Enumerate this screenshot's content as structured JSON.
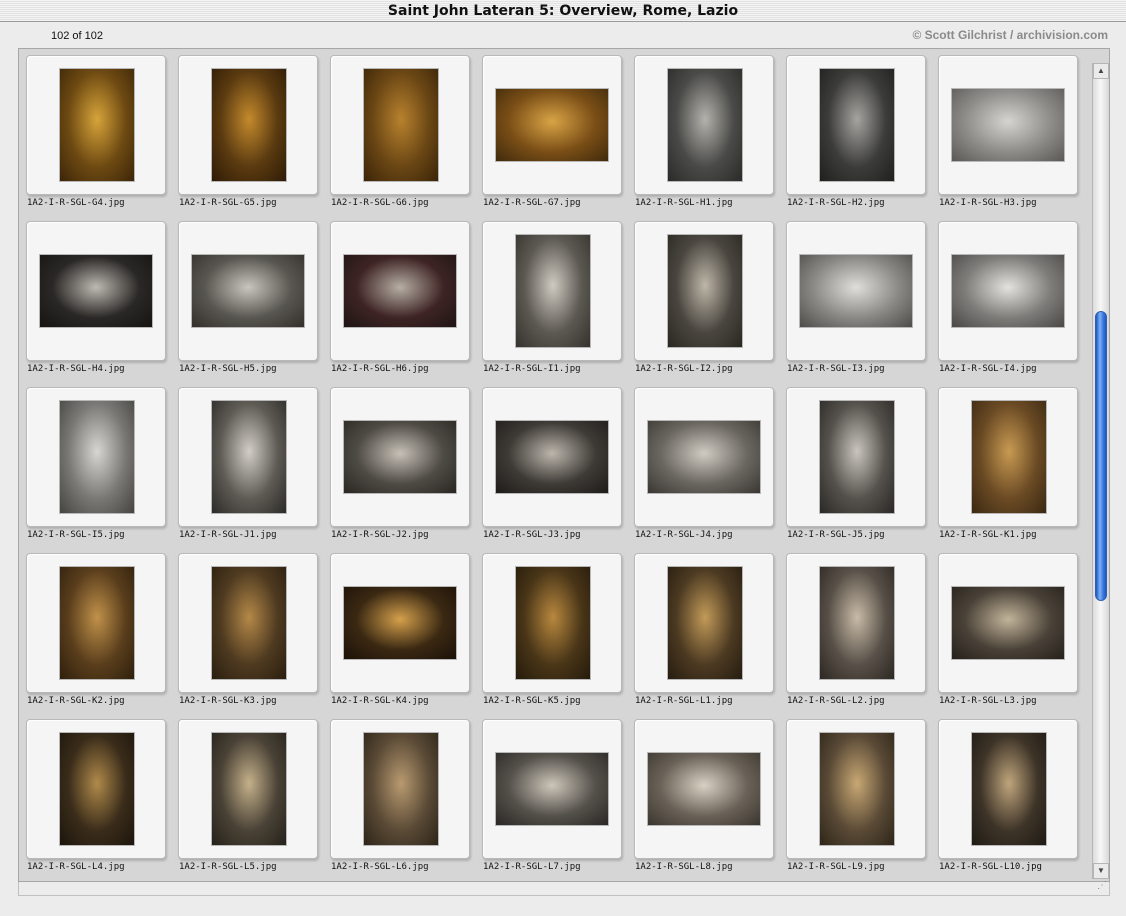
{
  "window": {
    "title": "Saint John Lateran 5: Overview, Rome, Lazio"
  },
  "info": {
    "counter": "102 of 102",
    "copyright": "© Scott Gilchrist / archivision.com"
  },
  "thumbnails": [
    {
      "label": "1A2-I-R-SGL-G4.jpg",
      "orientation": "portrait",
      "colors": [
        "#6e4a12",
        "#d7a43a",
        "#3b2508"
      ]
    },
    {
      "label": "1A2-I-R-SGL-G5.jpg",
      "orientation": "portrait",
      "colors": [
        "#5a3a10",
        "#c48a2c",
        "#2e1b06"
      ]
    },
    {
      "label": "1A2-I-R-SGL-G6.jpg",
      "orientation": "portrait",
      "colors": [
        "#6a4614",
        "#b8822e",
        "#3a2408"
      ]
    },
    {
      "label": "1A2-I-R-SGL-G7.jpg",
      "orientation": "landscape",
      "colors": [
        "#7a4e16",
        "#d9a446",
        "#3f2a0c"
      ]
    },
    {
      "label": "1A2-I-R-SGL-H1.jpg",
      "orientation": "portrait",
      "colors": [
        "#4a4a48",
        "#b4b2ac",
        "#2a2a28"
      ]
    },
    {
      "label": "1A2-I-R-SGL-H2.jpg",
      "orientation": "portrait",
      "colors": [
        "#3c3c3a",
        "#a6a4a0",
        "#1f1f1e"
      ]
    },
    {
      "label": "1A2-I-R-SGL-H3.jpg",
      "orientation": "landscape",
      "colors": [
        "#8e8c88",
        "#d6d4d0",
        "#5a5855"
      ]
    },
    {
      "label": "1A2-I-R-SGL-H4.jpg",
      "orientation": "landscape",
      "colors": [
        "#2a2826",
        "#bdb9b2",
        "#151413"
      ]
    },
    {
      "label": "1A2-I-R-SGL-H5.jpg",
      "orientation": "landscape",
      "colors": [
        "#585650",
        "#c8c5be",
        "#322f2b"
      ]
    },
    {
      "label": "1A2-I-R-SGL-H6.jpg",
      "orientation": "landscape",
      "colors": [
        "#3e2424",
        "#b6aea4",
        "#1f1414"
      ]
    },
    {
      "label": "1A2-I-R-SGL-I1.jpg",
      "orientation": "portrait",
      "colors": [
        "#5c5852",
        "#cfcac1",
        "#35322d"
      ]
    },
    {
      "label": "1A2-I-R-SGL-I2.jpg",
      "orientation": "portrait",
      "colors": [
        "#4a463f",
        "#bdb6a9",
        "#2a2722"
      ]
    },
    {
      "label": "1A2-I-R-SGL-I3.jpg",
      "orientation": "landscape",
      "colors": [
        "#8a8884",
        "#e0dedb",
        "#4e4c49"
      ]
    },
    {
      "label": "1A2-I-R-SGL-I4.jpg",
      "orientation": "landscape",
      "colors": [
        "#7e7c79",
        "#e4e2de",
        "#4a4846"
      ]
    },
    {
      "label": "1A2-I-R-SGL-I5.jpg",
      "orientation": "portrait",
      "colors": [
        "#7a7874",
        "#d8d6d2",
        "#45433f"
      ]
    },
    {
      "label": "1A2-I-R-SGL-J1.jpg",
      "orientation": "portrait",
      "colors": [
        "#5e5b55",
        "#d2cec6",
        "#2c2a27"
      ]
    },
    {
      "label": "1A2-I-R-SGL-J2.jpg",
      "orientation": "landscape",
      "colors": [
        "#4e4a44",
        "#c6c0b6",
        "#2a2723"
      ]
    },
    {
      "label": "1A2-I-R-SGL-J3.jpg",
      "orientation": "landscape",
      "colors": [
        "#3e3a36",
        "#bcb6ac",
        "#1e1c19"
      ]
    },
    {
      "label": "1A2-I-R-SGL-J4.jpg",
      "orientation": "landscape",
      "colors": [
        "#6a6660",
        "#d0cbc2",
        "#3a3733"
      ]
    },
    {
      "label": "1A2-I-R-SGL-J5.jpg",
      "orientation": "portrait",
      "colors": [
        "#55524d",
        "#c9c5bd",
        "#2a2825"
      ]
    },
    {
      "label": "1A2-I-R-SGL-K1.jpg",
      "orientation": "portrait",
      "colors": [
        "#6a4a24",
        "#c89a52",
        "#3a2812"
      ]
    },
    {
      "label": "1A2-I-R-SGL-K2.jpg",
      "orientation": "portrait",
      "colors": [
        "#5a3e1c",
        "#c0914a",
        "#2e1f0d"
      ]
    },
    {
      "label": "1A2-I-R-SGL-K3.jpg",
      "orientation": "portrait",
      "colors": [
        "#4e3a20",
        "#b48848",
        "#2a1e0f"
      ]
    },
    {
      "label": "1A2-I-R-SGL-K4.jpg",
      "orientation": "landscape",
      "colors": [
        "#3a2812",
        "#d4a04c",
        "#1c1208"
      ]
    },
    {
      "label": "1A2-I-R-SGL-K5.jpg",
      "orientation": "portrait",
      "colors": [
        "#4a3618",
        "#b8883e",
        "#241a0b"
      ]
    },
    {
      "label": "1A2-I-R-SGL-L1.jpg",
      "orientation": "portrait",
      "colors": [
        "#4c3a22",
        "#c29a58",
        "#261c10"
      ]
    },
    {
      "label": "1A2-I-R-SGL-L2.jpg",
      "orientation": "portrait",
      "colors": [
        "#585048",
        "#c8bba6",
        "#2c2722"
      ]
    },
    {
      "label": "1A2-I-R-SGL-L3.jpg",
      "orientation": "landscape",
      "colors": [
        "#4a4238",
        "#c2b49a",
        "#25201b"
      ]
    },
    {
      "label": "1A2-I-R-SGL-L4.jpg",
      "orientation": "portrait",
      "colors": [
        "#3a2c1a",
        "#b08a4a",
        "#1c150c"
      ]
    },
    {
      "label": "1A2-I-R-SGL-L5.jpg",
      "orientation": "portrait",
      "colors": [
        "#4a4236",
        "#c4b08a",
        "#25211a"
      ]
    },
    {
      "label": "1A2-I-R-SGL-L6.jpg",
      "orientation": "portrait",
      "colors": [
        "#5a4a36",
        "#b89a70",
        "#2c2418"
      ]
    },
    {
      "label": "1A2-I-R-SGL-L7.jpg",
      "orientation": "landscape",
      "colors": [
        "#54504a",
        "#cdc6ba",
        "#2a2825"
      ]
    },
    {
      "label": "1A2-I-R-SGL-L8.jpg",
      "orientation": "landscape",
      "colors": [
        "#6a6258",
        "#d8d0c2",
        "#3a352e"
      ]
    },
    {
      "label": "1A2-I-R-SGL-L9.jpg",
      "orientation": "portrait",
      "colors": [
        "#5a4a36",
        "#c8a874",
        "#2e2518"
      ]
    },
    {
      "label": "1A2-I-R-SGL-L10.jpg",
      "orientation": "portrait",
      "colors": [
        "#3e3428",
        "#bfa57c",
        "#1e1a14"
      ]
    }
  ],
  "scrollbar": {
    "position": 0.47
  }
}
